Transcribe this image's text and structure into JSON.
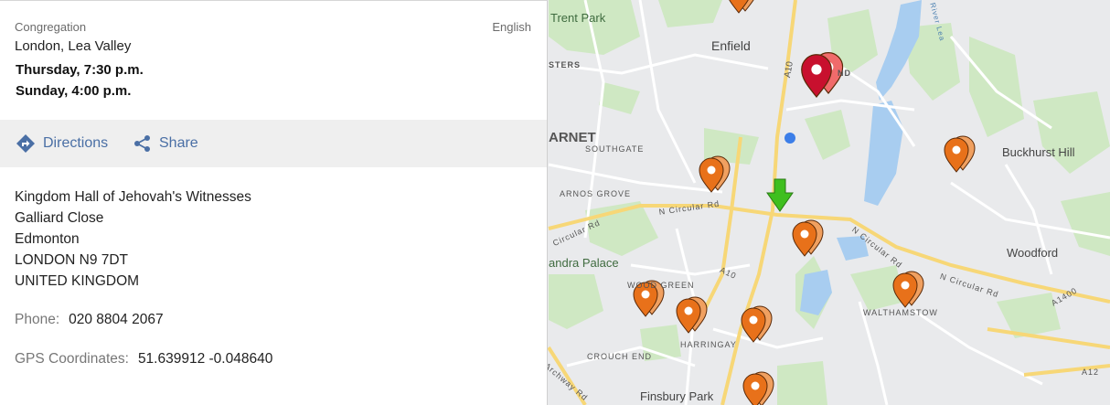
{
  "panel": {
    "kind": "Congregation",
    "language": "English",
    "name": "London, Lea Valley",
    "meeting_times": [
      "Thursday, 7:30 p.m.",
      "Sunday, 4:00 p.m."
    ],
    "actions": {
      "directions": "Directions",
      "share": "Share"
    },
    "address": [
      "Kingdom Hall of Jehovah's Witnesses",
      "Galliard Close",
      "Edmonton",
      "LONDON N9 7DT",
      "UNITED KINGDOM"
    ],
    "phone_label": "Phone:",
    "phone": "020 8804 2067",
    "gps_label": "GPS Coordinates:",
    "gps": "51.639912 -0.048640"
  },
  "map": {
    "labels": {
      "trent_park": "Trent Park",
      "enfield": "Enfield",
      "a10_north": "A10",
      "sters": "STERS",
      "barnet": "ARNET",
      "southgate": "SOUTHGATE",
      "buckhurst_hill": "Buckhurst Hill",
      "arnos_grove": "ARNOS GROVE",
      "n_circular_west": "N Circular Rd",
      "circular_rd_left": "Circular Rd",
      "n_circular_east": "N Circular Rd",
      "woodford": "Woodford",
      "alexandra_palace": "andra Palace",
      "a10_south": "A10",
      "wood_green": "WOOD GREEN",
      "n_circular_far_east": "N Circular Rd",
      "a1400": "A1400",
      "walthamstow": "WALTHAMSTOW",
      "harringay": "HARRINGAY",
      "crouch_end": "CROUCH END",
      "archway_rd": "Archway Rd",
      "finsbury_park": "Finsbury Park",
      "a12": "A12",
      "river_lea": "River Lea",
      "ponders_end_partial": "ND"
    },
    "marker_colors": {
      "orange": "#e8711a",
      "selected": "#c8102e",
      "user": "#3c7ee8",
      "arrow": "#3fbf1f"
    }
  }
}
